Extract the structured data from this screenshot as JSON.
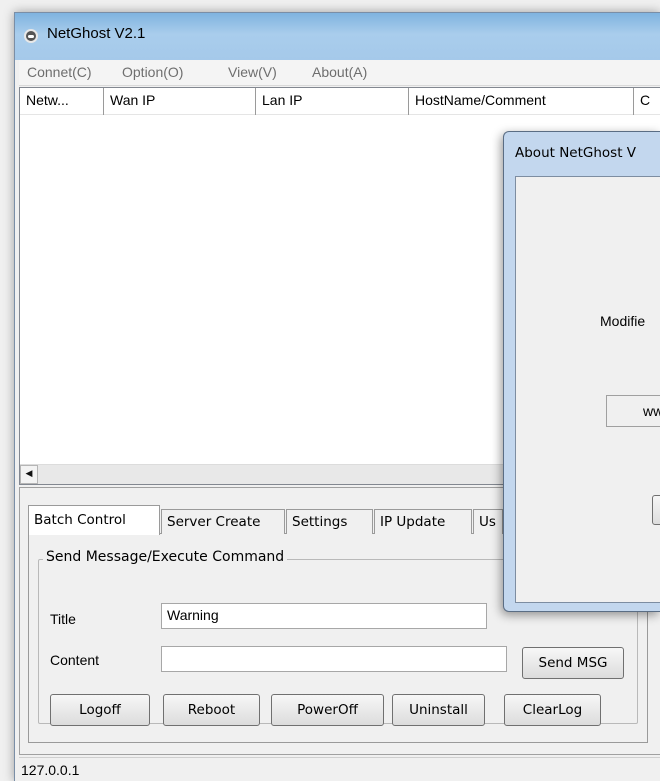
{
  "window": {
    "title": "NetGhost V2.1"
  },
  "menu": [
    "Connet(C)",
    "Option(O)",
    "View(V)",
    "About(A)"
  ],
  "list": {
    "columns": [
      "Netw...",
      "Wan IP",
      "Lan IP",
      "HostName/Comment",
      "C"
    ]
  },
  "tabs": [
    "Batch Control",
    "Server Create",
    "Settings",
    "IP Update",
    "Us"
  ],
  "batch": {
    "group_title": "Send Message/Execute Command",
    "title_label": "Title",
    "title_value": "Warning",
    "content_label": "Content",
    "content_value": "",
    "send_msg": "Send MSG",
    "buttons": [
      "Logoff",
      "Reboot",
      "PowerOff",
      "Uninstall",
      "ClearLog"
    ]
  },
  "status": {
    "text": "127.0.0.1"
  },
  "about": {
    "title": "About NetGhost V",
    "text": "Modifie",
    "field_text": "ww"
  }
}
